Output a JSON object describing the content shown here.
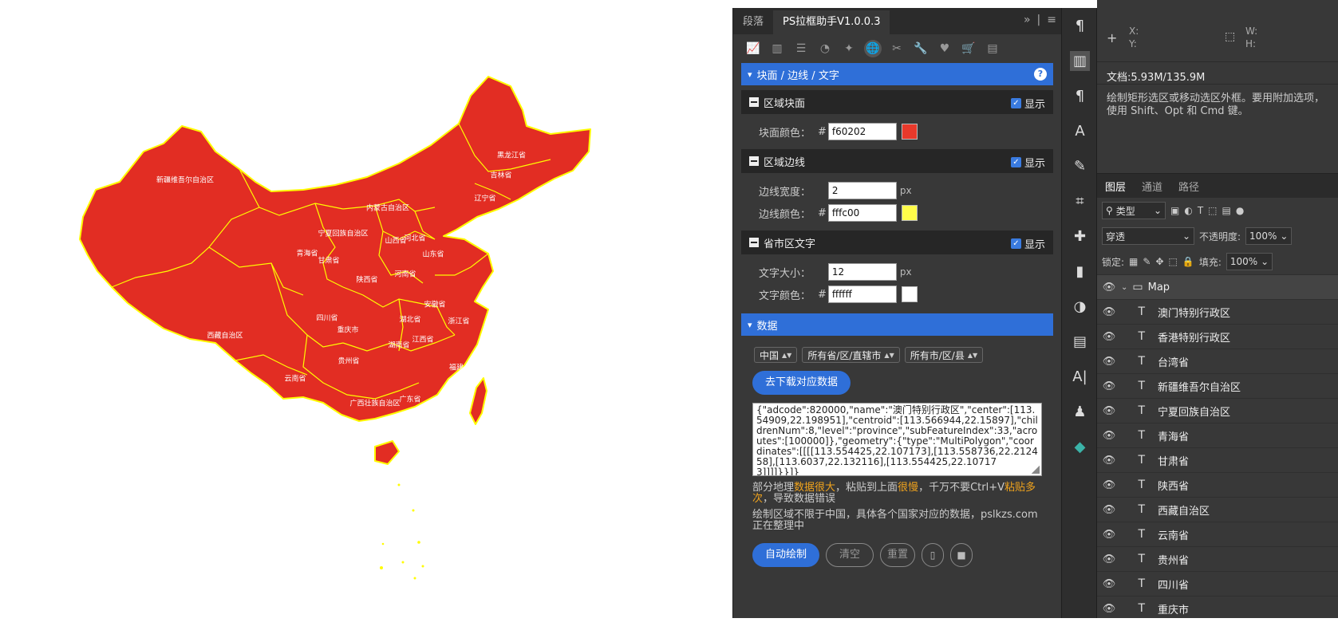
{
  "map": {
    "fill_color": "#e22d23",
    "border_color": "#fffc00",
    "label_color": "#ffffff",
    "labels": [
      {
        "id": "xinjiang",
        "text": "新疆维吾尔自治区"
      },
      {
        "id": "xizang",
        "text": "西藏自治区"
      },
      {
        "id": "neimenggu",
        "text": "内蒙古自治区"
      },
      {
        "id": "heilongjiang",
        "text": "黑龙江省"
      },
      {
        "id": "jilin",
        "text": "吉林省"
      },
      {
        "id": "liaoning",
        "text": "辽宁省"
      },
      {
        "id": "hebei",
        "text": "河北省"
      },
      {
        "id": "shandong",
        "text": "山东省"
      },
      {
        "id": "shanxi",
        "text": "山西省"
      },
      {
        "id": "ningxia",
        "text": "宁夏回族自治区"
      },
      {
        "id": "qinghai",
        "text": "青海省"
      },
      {
        "id": "gansu",
        "text": "甘肃省"
      },
      {
        "id": "shaanxi",
        "text": "陕西省"
      },
      {
        "id": "henan",
        "text": "河南省"
      },
      {
        "id": "sichuan",
        "text": "四川省"
      },
      {
        "id": "chongqing",
        "text": "重庆市"
      },
      {
        "id": "hubei",
        "text": "湖北省"
      },
      {
        "id": "anhui",
        "text": "安徽省"
      },
      {
        "id": "zhejiang",
        "text": "浙江省"
      },
      {
        "id": "jiangxi",
        "text": "江西省"
      },
      {
        "id": "hunan",
        "text": "湖南省"
      },
      {
        "id": "guizhou",
        "text": "贵州省"
      },
      {
        "id": "yunnan",
        "text": "云南省"
      },
      {
        "id": "guangxi",
        "text": "广西壮族自治区"
      },
      {
        "id": "guangdong",
        "text": "广东省"
      },
      {
        "id": "fujian",
        "text": "福建"
      }
    ]
  },
  "plugin": {
    "tabs": [
      "段落",
      "PS拉框助手V1.0.0.3"
    ],
    "section_main": "块面 / 边线 / 文字",
    "show_label": "显示",
    "region_fill": {
      "title": "区域块面",
      "label": "块面颜色：",
      "hash": "#",
      "value": "f60202",
      "swatch": "#e8392b"
    },
    "region_border": {
      "title": "区域边线",
      "width_label": "边线宽度：",
      "width_value": "2",
      "unit": "px",
      "color_label": "边线颜色：",
      "hash": "#",
      "color_value": "fffc00",
      "swatch": "#fffc4a"
    },
    "region_text": {
      "title": "省市区文字",
      "size_label": "文字大小：",
      "size_value": "12",
      "unit": "px",
      "color_label": "文字颜色：",
      "hash": "#",
      "color_value": "ffffff",
      "swatch": "#ffffff"
    },
    "section_data": "数据",
    "selects": [
      "中国",
      "所有省/区/直辖市",
      "所有市/区/县"
    ],
    "download_button": "去下载对应数据",
    "json_text": "{\"adcode\":820000,\"name\":\"澳门特别行政区\",\"center\":[113.54909,22.198951],\"centroid\":[113.566944,22.15897],\"childrenNum\":8,\"level\":\"province\",\"subFeatureIndex\":33,\"acroutes\":[100000]},\"geometry\":{\"type\":\"MultiPolygon\",\"coordinates\":[[[[113.554425,22.107173],[113.558736,22.212458],[113.6037,22.132116],[113.554425,22.107173]]]]}}]}",
    "note1_a": "部分地理",
    "note1_b": "数据很大",
    "note1_c": "，粘贴到上面",
    "note1_d": "很慢",
    "note1_e": "，千万不要Ctrl+V",
    "note1_f": "粘贴多次",
    "note1_g": "，导致数据错误",
    "note2": "绘制区域不限于中国，具体各个国家对应的数据，pslkzs.com正在整理中",
    "auto_button": "自动绘制",
    "clear_button": "清空",
    "reset_button": "重置"
  },
  "ps": {
    "info_x": "X:",
    "info_y": "Y:",
    "info_w": "W:",
    "info_h": "H:",
    "doc": "文档:5.93M/135.9M",
    "hint": "绘制矩形选区或移动选区外框。要用附加选项，使用 Shift、Opt 和 Cmd 键。",
    "layer_tabs": [
      "图层",
      "通道",
      "路径"
    ],
    "kind_label": "类型",
    "blend_mode": "穿透",
    "opacity_label": "不透明度:",
    "opacity_value": "100%",
    "lock_label": "锁定:",
    "fill_label": "填充:",
    "fill_value": "100%",
    "group_name": "Map",
    "layers": [
      "澳门特别行政区",
      "香港特别行政区",
      "台湾省",
      "新疆维吾尔自治区",
      "宁夏回族自治区",
      "青海省",
      "甘肃省",
      "陕西省",
      "西藏自治区",
      "云南省",
      "贵州省",
      "四川省",
      "重庆市"
    ]
  }
}
